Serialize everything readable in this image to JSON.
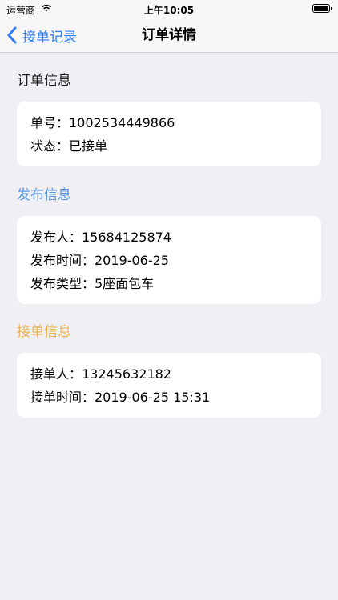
{
  "status_bar": {
    "carrier": "运营商",
    "time": "上午10:05"
  },
  "nav": {
    "back_label": "接单记录",
    "title": "订单详情"
  },
  "order_section": {
    "title": "订单信息",
    "title_color": "#222222",
    "rows": [
      "单号：1002534449866",
      "状态：已接单"
    ]
  },
  "publish_section": {
    "title": "发布信息",
    "title_color": "#5b97e6",
    "rows": [
      "发布人：15684125874",
      "发布时间：2019-06-25",
      "发布类型：5座面包车"
    ]
  },
  "accept_section": {
    "title": "接单信息",
    "title_color": "#ebb24d",
    "rows": [
      "接单人：13245632182",
      "接单时间：2019-06-25 15:31"
    ]
  },
  "icons": {
    "wifi": "wifi-icon",
    "battery": "battery-icon",
    "back": "chevron-left-icon"
  },
  "colors": {
    "accent": "#2f7cf6",
    "background": "#efeff4"
  }
}
